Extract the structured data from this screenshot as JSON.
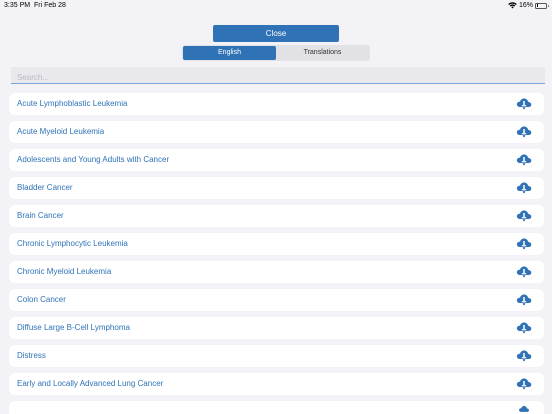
{
  "status_bar": {
    "time": "3:35 PM",
    "date": "Fri Feb 28",
    "battery": "16%",
    "battery_level": 0.16,
    "wifi_icon": "wifi-icon",
    "battery_icon": "battery-icon"
  },
  "header": {
    "close_label": "Close",
    "tabs": [
      {
        "label": "English",
        "selected": true
      },
      {
        "label": "Translations",
        "selected": false
      }
    ]
  },
  "search": {
    "placeholder": "Search...",
    "value": ""
  },
  "colors": {
    "accent": "#2f72b5",
    "link_text": "#2e73b8",
    "background": "#f2f2f7",
    "row_background": "#ffffff"
  },
  "list": {
    "download_icon": "cloud-download-icon",
    "items": [
      {
        "label": "Acute Lymphoblastic Leukemia"
      },
      {
        "label": "Acute Myeloid Leukemia"
      },
      {
        "label": "Adolescents and Young Adults with Cancer"
      },
      {
        "label": "Bladder Cancer"
      },
      {
        "label": "Brain Cancer"
      },
      {
        "label": "Chronic Lymphocytic Leukemia"
      },
      {
        "label": "Chronic Myeloid Leukemia"
      },
      {
        "label": "Colon Cancer"
      },
      {
        "label": "Diffuse Large B-Cell Lymphoma"
      },
      {
        "label": "Distress"
      },
      {
        "label": "Early and Locally Advanced Lung Cancer"
      }
    ]
  }
}
